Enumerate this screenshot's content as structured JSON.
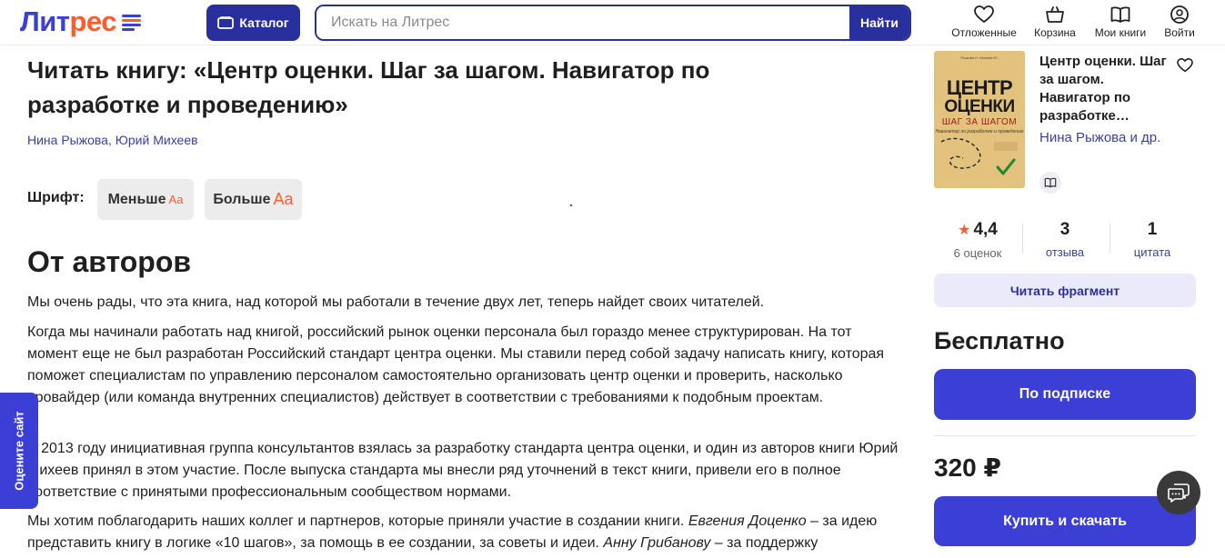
{
  "header": {
    "logo_part1": "Лит",
    "logo_part2": "рес",
    "catalog_label": "Каталог",
    "search_placeholder": "Искать на Литрес",
    "search_button": "Найти",
    "nav": {
      "deferred": "Отложенные",
      "cart": "Корзина",
      "my_books": "Мои книги",
      "login": "Войти"
    }
  },
  "main": {
    "title": "Читать книгу: «Центр оценки. Шаг за шагом. Навигатор по разработке и проведению»",
    "authors": [
      "Нина Рыжова",
      "Юрий Михеев"
    ],
    "author_separator": ", ",
    "font_label": "Шрифт:",
    "font_smaller": "Меньше",
    "font_larger": "Больше",
    "font_glyph": "Aa",
    "section_heading": "От авторов",
    "p1": "Мы очень рады, что эта книга, над которой мы работали в течение двух лет, теперь найдет своих читателей.",
    "p2": "Когда мы начинали работать над книгой, российский рынок оценки персонала был гораздо менее структурирован. На тот момент еще не был разработан Российский стандарт центра оценки. Мы ставили перед собой задачу написать книгу, которая поможет специалистам по управлению персоналом самостоятельно организовать центр оценки и проверить, насколько провайдер (или команда внутренних специалистов) действует в соответствии с требованиями к подобным проектам.",
    "p3": "В 2013 году инициативная группа консультантов взялась за разработку стандарта центра оценки, и один из авторов книги Юрий Михеев принял в этом участие. После выпуска стандарта мы внесли ряд уточнений в текст книги, привели его в полное соответствие с принятыми профессиональным сообществом нормами.",
    "p4_a": "Мы хотим поблагодарить наших коллег и партнеров, которые приняли участие в создании книги. ",
    "p4_name1": "Евгения Доценко",
    "p4_b": " – за идею представить книгу в логике «10 шагов», за помощь в ее создании, за советы и идеи. ",
    "p4_name2": "Анну Грибанову",
    "p4_c": " – за поддержку"
  },
  "feedback_tab": "Оцените сайт",
  "sidebar": {
    "cover": {
      "author_line": "Рыжова Н.   Михеев Ю.",
      "line1": "ЦЕНТР",
      "line2": "ОЦЕНКИ",
      "line3": "ШАГ ЗА ШАГОМ",
      "subtitle": "Навигатор по разработке и проведению"
    },
    "book_title": "Центр оценки. Шаг за шагом. Навигатор по разработке…",
    "authors": "Нина Рыжова и др.",
    "rating_value": "4,4",
    "rating_count": "6 оценок",
    "reviews_value": "3",
    "reviews_label": "отзыва",
    "quotes_value": "1",
    "quotes_label": "цитата",
    "read_fragment": "Читать фрагмент",
    "free_label": "Бесплатно",
    "subscribe_button": "По подписке",
    "price": "320 ₽",
    "buy_button": "Купить и скачать"
  },
  "colors": {
    "brand_blue": "#3b3fd6",
    "brand_dark_blue": "#2a2f9e",
    "brand_orange": "#ff5c2e",
    "link_blue": "#3b3fa8"
  }
}
